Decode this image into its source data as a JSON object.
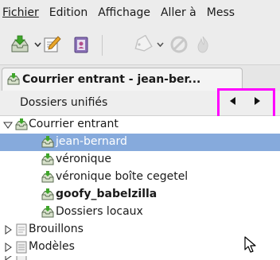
{
  "menubar": {
    "items": [
      {
        "label": "Fichier"
      },
      {
        "label": "Edition"
      },
      {
        "label": "Affichage"
      },
      {
        "label": "Aller à"
      },
      {
        "label": "Mess"
      }
    ]
  },
  "toolbar": {
    "get_mail_icon": "inbox-download-icon",
    "write_icon": "pencil-notepad-icon",
    "address_book_icon": "address-book-icon",
    "tag_icon": "tag-icon",
    "junk_icon": "block-icon",
    "delete_icon": "flame-icon"
  },
  "tab": {
    "title": "Courrier entrant - jean-ber..."
  },
  "folder_pane": {
    "title": "Dossiers unifiés"
  },
  "tree": {
    "rows": [
      {
        "label": "Courrier entrant"
      },
      {
        "label": "jean-bernard"
      },
      {
        "label": "véronique"
      },
      {
        "label": "véronique boîte cegetel"
      },
      {
        "label": "goofy_babelzilla"
      },
      {
        "label": "Dossiers locaux"
      },
      {
        "label": "Brouillons"
      },
      {
        "label": "Modèles"
      }
    ]
  },
  "colors": {
    "selection": "#86aadc",
    "highlight_box": "#ff00ff",
    "inbox_icon_green": "#3fa52b"
  }
}
